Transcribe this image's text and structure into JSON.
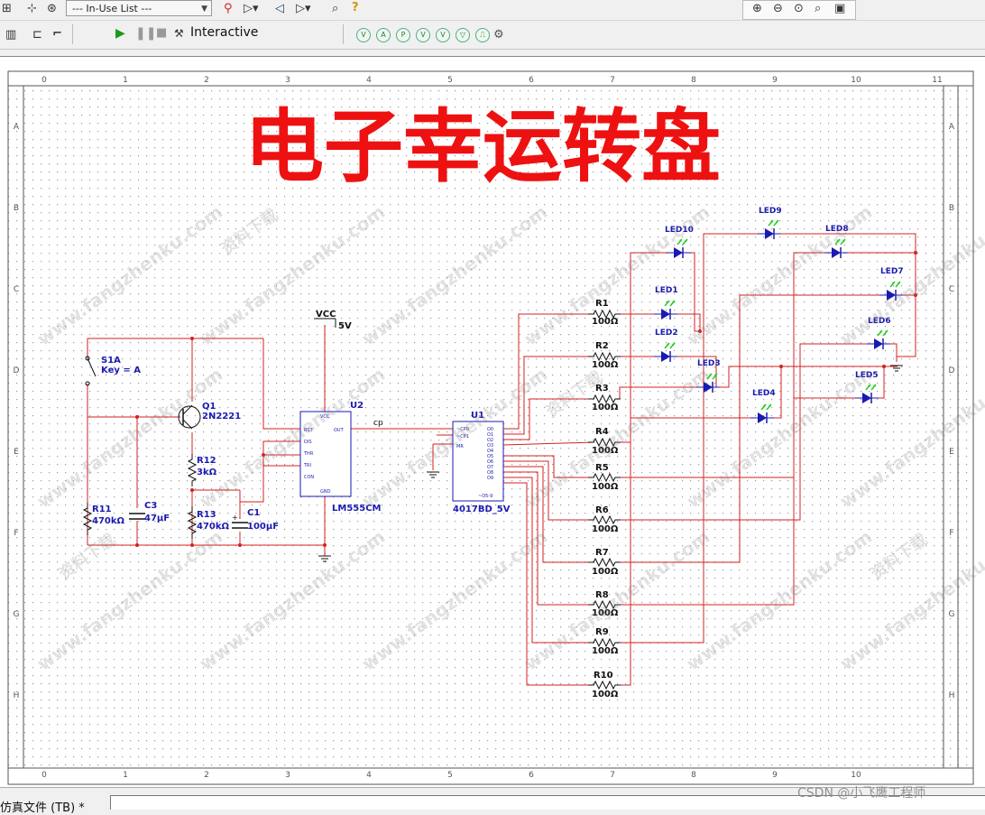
{
  "toolbar1": {
    "list_select": "--- In-Use List ---",
    "help_icon": "?"
  },
  "toolbar2": {
    "mode_label": "Interactive"
  },
  "schematic": {
    "title": "电子幸运转盘",
    "border_numbers": [
      "0",
      "1",
      "2",
      "3",
      "4",
      "5",
      "6",
      "7",
      "8",
      "9",
      "10",
      "11"
    ],
    "border_letters": [
      "A",
      "B",
      "C",
      "D",
      "E",
      "F",
      "G",
      "H"
    ],
    "switch_label": "S1A",
    "switch_key": "Key = A",
    "q1_label": "Q1",
    "q1_part": "2N2221",
    "r11_label": "R11",
    "r11_value": "470kΩ",
    "c3_label": "C3",
    "c3_value": "47μF",
    "r12_label": "R12",
    "r12_value": "3kΩ",
    "r13_label": "R13",
    "r13_value": "470kΩ",
    "c1_label": "C1",
    "c1_value": "100μF",
    "vcc_label": "VCC",
    "vcc_value": "5V",
    "u2_label": "U2",
    "u2_part": "LM555CM",
    "u2_pins": [
      "RST",
      "DIS",
      "THR",
      "TRI",
      "CON",
      "GND",
      "VCC",
      "OUT"
    ],
    "cp_label": "cp",
    "u1_label": "U1",
    "u1_part": "4017BD_5V",
    "u1_pins_left": [
      "~CP0",
      "~CP1",
      "MR"
    ],
    "u1_pins_right": [
      "O0",
      "O1",
      "O2",
      "O3",
      "O4",
      "O5",
      "O6",
      "O7",
      "O8",
      "O9",
      "~O5-9"
    ],
    "resistors": [
      {
        "label": "R1",
        "value": "100Ω"
      },
      {
        "label": "R2",
        "value": "100Ω"
      },
      {
        "label": "R3",
        "value": "100Ω"
      },
      {
        "label": "R4",
        "value": "100Ω"
      },
      {
        "label": "R5",
        "value": "100Ω"
      },
      {
        "label": "R6",
        "value": "100Ω"
      },
      {
        "label": "R7",
        "value": "100Ω"
      },
      {
        "label": "R8",
        "value": "100Ω"
      },
      {
        "label": "R9",
        "value": "100Ω"
      },
      {
        "label": "R10",
        "value": "100Ω"
      }
    ],
    "leds": [
      "LED1",
      "LED2",
      "LED3",
      "LED4",
      "LED5",
      "LED6",
      "LED7",
      "LED8",
      "LED9",
      "LED10"
    ],
    "watermark_cn": "资料下载",
    "watermark_url": "www.fangzhenku.com"
  },
  "status_bar": {
    "label": "仿真文件 (TB) *",
    "credit": "CSDN @小飞鹰工程师"
  },
  "colors": {
    "wire": "#d42020",
    "component": "#1a1ab0",
    "title": "#ee1111",
    "led_glow": "#22cc22"
  }
}
